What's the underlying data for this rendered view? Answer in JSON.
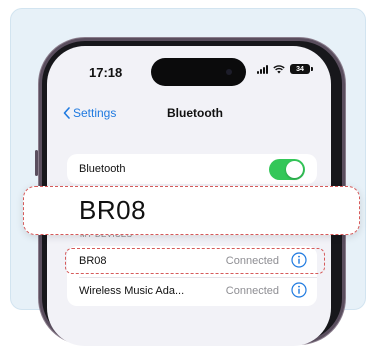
{
  "status_bar": {
    "time": "17:18",
    "battery": "34"
  },
  "nav": {
    "back_label": "Settings",
    "title": "Bluetooth"
  },
  "bluetooth_row": {
    "label": "Bluetooth",
    "enabled": true
  },
  "callout": {
    "text": "BR08"
  },
  "section": {
    "label": "MY DEVICES"
  },
  "devices": [
    {
      "name": "BR08",
      "status": "Connected"
    },
    {
      "name": "Wireless Music Ada...",
      "status": "Connected"
    }
  ],
  "colors": {
    "accent": "#1f7ae0",
    "toggle_on": "#34c759",
    "highlight_border": "#d65a5a",
    "card_background": "#e7f1f8"
  }
}
